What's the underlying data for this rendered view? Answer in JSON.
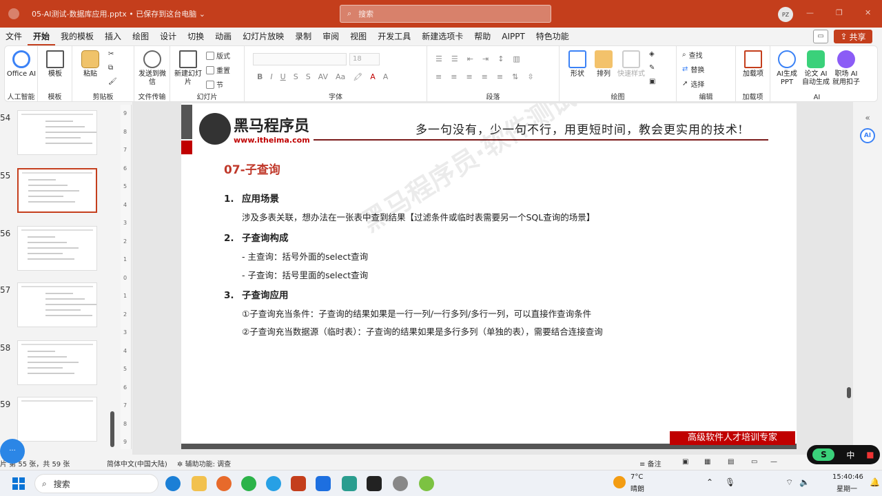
{
  "titlebar": {
    "file_title": "05-AI测试-数据库应用.pptx • 已保存到这台电脑 ⌄",
    "search_placeholder": "搜索",
    "avatar": "PZ"
  },
  "menu": [
    "文件",
    "开始",
    "我的模板",
    "插入",
    "绘图",
    "设计",
    "切换",
    "动画",
    "幻灯片放映",
    "录制",
    "审阅",
    "视图",
    "开发工具",
    "新建选项卡",
    "帮助",
    "AIPPT",
    "特色功能"
  ],
  "share_label": "共享",
  "ribbon": {
    "office_ai": "Office AI",
    "grp_ai": "人工智能",
    "template": "模板",
    "grp_template": "模板",
    "paste": "粘贴",
    "grp_clipboard": "剪贴板",
    "send_wechat": "发送到微信",
    "grp_transfer": "文件传输",
    "new_slide": "新建幻灯片",
    "layout": "版式",
    "reset": "重置",
    "section": "节",
    "grp_slides": "幻灯片",
    "font_size": "18",
    "grp_font": "字体",
    "grp_paragraph": "段落",
    "shape": "形状",
    "arrange": "排列",
    "quick_style": "快速样式",
    "grp_drawing": "绘图",
    "find": "查找",
    "replace": "替换",
    "select": "选择",
    "grp_edit": "编辑",
    "addin": "加载项",
    "grp_addin": "加载项",
    "ai_ppt": "AI生成PPT",
    "paper_ai": "论文 AI 自动生成",
    "job_ai": "职场 AI 就用扣子",
    "grp_ai2": "AI"
  },
  "thumbnails": [
    {
      "num": "54",
      "selected": false
    },
    {
      "num": "55",
      "selected": true
    },
    {
      "num": "56",
      "selected": false
    },
    {
      "num": "57",
      "selected": false
    },
    {
      "num": "58",
      "selected": false
    },
    {
      "num": "59",
      "selected": false
    }
  ],
  "slide": {
    "logo_cn": "黑马程序员",
    "logo_url": "www.itheima.com",
    "slogan": "多一句没有，少一句不行，用更短时间，教会更实用的技术!",
    "title": "07-子查询",
    "s1_num": "1.",
    "s1_head": "应用场景",
    "s1_text": "涉及多表关联，想办法在一张表中查到结果【过滤条件或临时表需要另一个SQL查询的场景】",
    "s2_num": "2.",
    "s2_head": "子查询构成",
    "s2_a": "- 主查询：括号外面的select查询",
    "s2_b": "- 子查询：括号里面的select查询",
    "s3_num": "3.",
    "s3_head": "子查询应用",
    "s3_a": "①子查询充当条件：子查询的结果如果是一行一列/一行多列/多行一列，可以直接作查询条件",
    "s3_b": "②子查询充当数据源（临时表）：子查询的结果如果是多行多列（单独的表），需要结合连接查询",
    "watermark": "黑马程序员·软件测试",
    "bottom_tag": "高级软件人才培训专家"
  },
  "status": {
    "slide_info": "片 第 55 张，共 59 张",
    "language": "简体中文(中国大陆)",
    "accessibility": "辅助功能: 调查",
    "notes": "备注"
  },
  "ime": {
    "logo": "S",
    "lang": "中"
  },
  "taskbar": {
    "search": "搜索",
    "weather_temp": "7°C",
    "weather_desc": "晴朗",
    "time": "15:40:46",
    "date": "星期一"
  },
  "colors": {
    "accent": "#c43e1c",
    "slide_red": "#c00000",
    "title_red": "#c0392b"
  }
}
